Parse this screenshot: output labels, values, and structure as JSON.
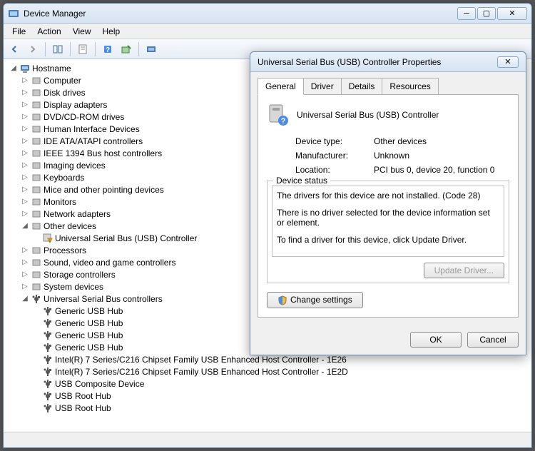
{
  "window": {
    "title": "Device Manager"
  },
  "menu": {
    "file": "File",
    "action": "Action",
    "view": "View",
    "help": "Help"
  },
  "tree": {
    "root": "Hostname",
    "categories": [
      "Computer",
      "Disk drives",
      "Display adapters",
      "DVD/CD-ROM drives",
      "Human Interface Devices",
      "IDE ATA/ATAPI controllers",
      "IEEE 1394 Bus host controllers",
      "Imaging devices",
      "Keyboards",
      "Mice and other pointing devices",
      "Monitors",
      "Network adapters"
    ],
    "other_devices": {
      "label": "Other devices",
      "items": [
        "Universal Serial Bus (USB) Controller"
      ]
    },
    "more_categories": [
      "Processors",
      "Sound, video and game controllers",
      "Storage controllers",
      "System devices"
    ],
    "usb": {
      "label": "Universal Serial Bus controllers",
      "items": [
        "Generic USB Hub",
        "Generic USB Hub",
        "Generic USB Hub",
        "Generic USB Hub",
        "Intel(R) 7 Series/C216 Chipset Family USB Enhanced Host Controller - 1E26",
        "Intel(R) 7 Series/C216 Chipset Family USB Enhanced Host Controller - 1E2D",
        "USB Composite Device",
        "USB Root Hub",
        "USB Root Hub"
      ]
    }
  },
  "dialog": {
    "title": "Universal Serial Bus (USB) Controller Properties",
    "tabs": {
      "general": "General",
      "driver": "Driver",
      "details": "Details",
      "resources": "Resources"
    },
    "device_name": "Universal Serial Bus (USB) Controller",
    "labels": {
      "device_type": "Device type:",
      "manufacturer": "Manufacturer:",
      "location": "Location:"
    },
    "values": {
      "device_type": "Other devices",
      "manufacturer": "Unknown",
      "location": "PCI bus 0, device 20, function 0"
    },
    "status_legend": "Device status",
    "status": {
      "l1": "The drivers for this device are not installed. (Code 28)",
      "l2": "There is no driver selected for the device information set or element.",
      "l3": "To find a driver for this device, click Update Driver."
    },
    "update_btn": "Update Driver...",
    "change_btn": "Change settings",
    "ok": "OK",
    "cancel": "Cancel"
  }
}
